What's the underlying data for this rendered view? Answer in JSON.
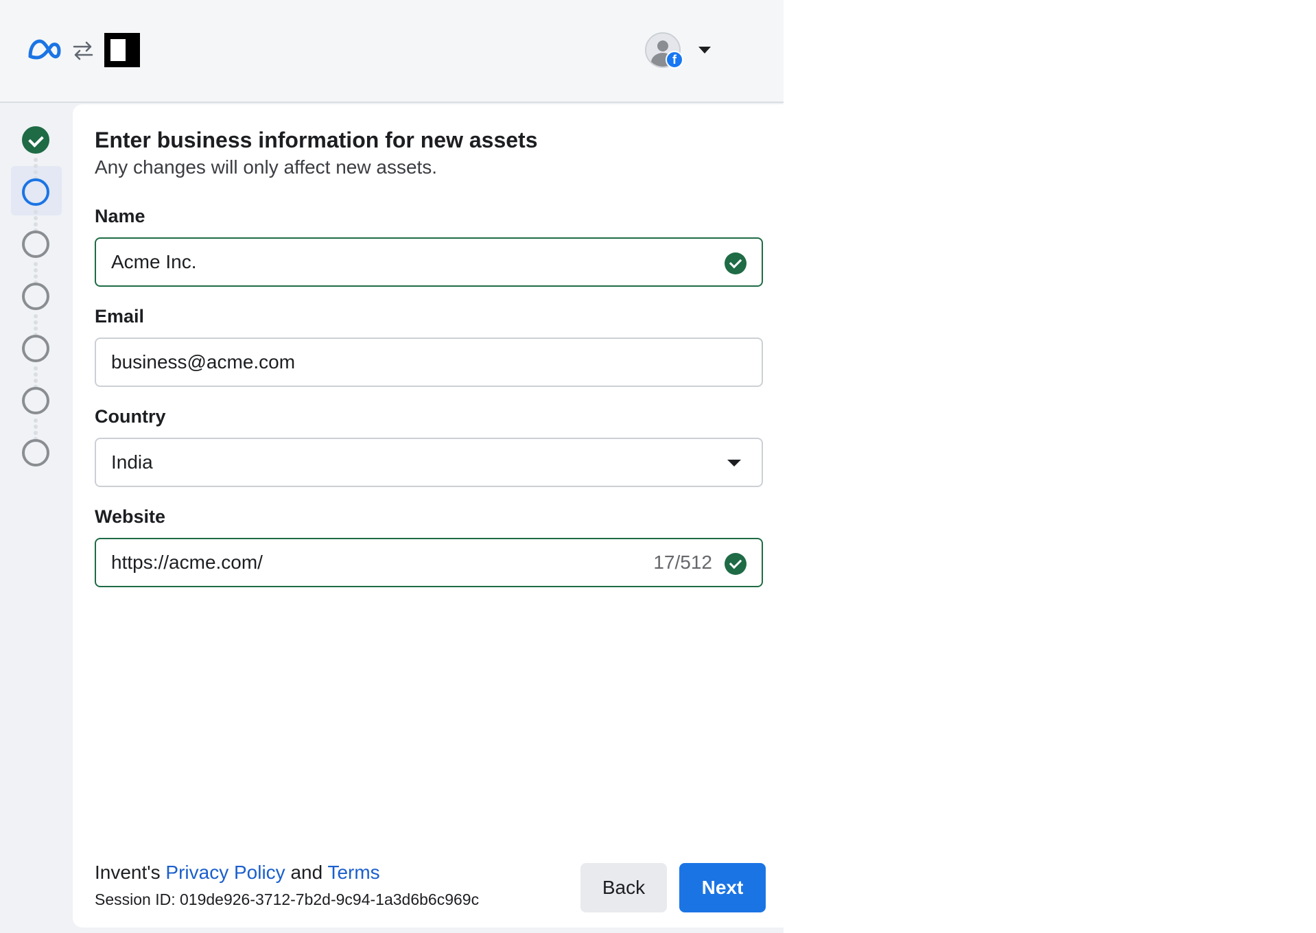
{
  "header": {
    "meta_logo_icon": "meta-infinity-logo",
    "swap_icon": "swap-arrows-icon",
    "app_logo_icon": "app-logo",
    "account_menu_icon": "chevron-down-icon",
    "badge_letter": "f"
  },
  "stepper": {
    "steps": [
      {
        "state": "done"
      },
      {
        "state": "current"
      },
      {
        "state": "pending"
      },
      {
        "state": "pending"
      },
      {
        "state": "pending"
      },
      {
        "state": "pending"
      },
      {
        "state": "pending"
      }
    ]
  },
  "form": {
    "title": "Enter business information for new assets",
    "subtitle": "Any changes will only affect new assets.",
    "name": {
      "label": "Name",
      "value": "Acme Inc."
    },
    "email": {
      "label": "Email",
      "value": "business@acme.com"
    },
    "country": {
      "label": "Country",
      "value": "India"
    },
    "website": {
      "label": "Website",
      "value": "https://acme.com/",
      "counter": "17/512"
    }
  },
  "footer": {
    "legal_prefix": "Invent's ",
    "privacy_link": "Privacy Policy",
    "legal_and": " and ",
    "terms_link": "Terms",
    "session": "Session ID: 019de926-3712-7b2d-9c94-1a3d6b6c969c",
    "back_label": "Back",
    "next_label": "Next"
  },
  "colors": {
    "accent": "#1b74e4",
    "success": "#1e6b45",
    "link": "#1b5fcc"
  }
}
